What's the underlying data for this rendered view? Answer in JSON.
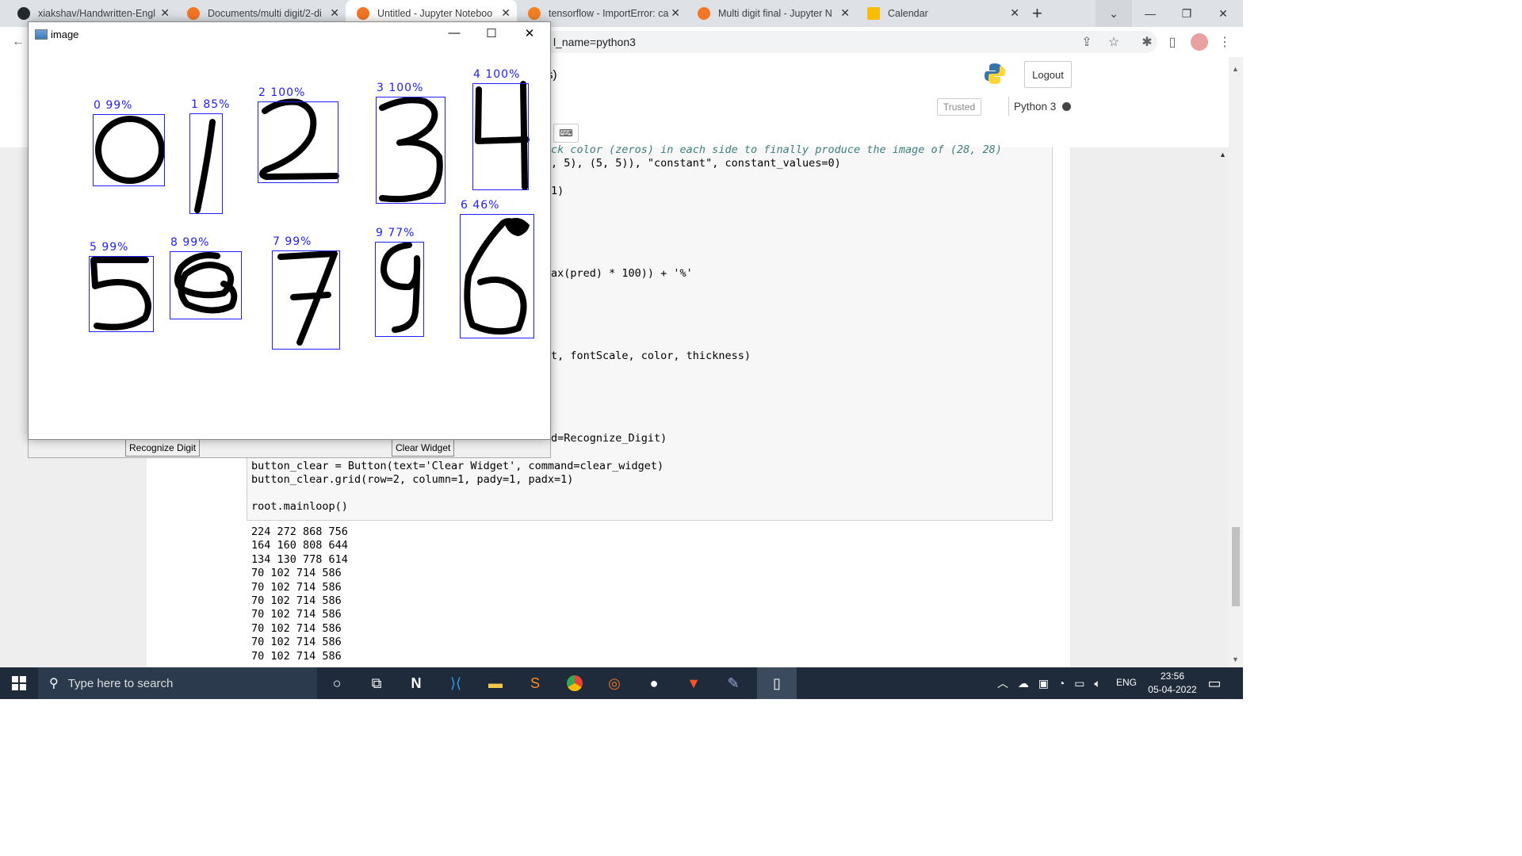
{
  "browser": {
    "tabs": [
      {
        "title": "xiakshav/Handwritten-Engl",
        "icon": "github-icon"
      },
      {
        "title": "Documents/multi digit/2-di",
        "icon": "jupyter-icon"
      },
      {
        "title": "Untitled - Jupyter Noteboo",
        "icon": "jupyter-icon"
      },
      {
        "title": "tensorflow - ImportError: ca",
        "icon": "stackoverflow-icon"
      },
      {
        "title": "Multi digit final - Jupyter N",
        "icon": "jupyter-icon"
      },
      {
        "title": "Calendar",
        "icon": "calendar-icon"
      }
    ],
    "new_tab": "+",
    "url_fragment": "l_name=python3"
  },
  "jupyter": {
    "header_fragment": "s)",
    "logout_label": "Logout",
    "trusted_label": "Trusted",
    "kernel_label": "Python 3",
    "keyboard_icon": "⌨"
  },
  "code": {
    "lines": [
      {
        "t": "ck color (zeros) in each side to finally produce the image of (28, 28)"
      },
      {
        "t": ", 5), (5, 5)), \"constant\", constant_values=0)"
      },
      {
        "t": "1)"
      },
      {
        "t": "ax(pred) * 100)) + '%'"
      },
      {
        "t": "t, fontScale, color, thickness)"
      },
      {
        "t": "d=Recognize_Digit)"
      },
      {
        "t": "button_clear = Button(text='Clear Widget', command=clear_widget)"
      },
      {
        "t": "button_clear.grid(row=2, column=1, pady=1, padx=1)"
      },
      {
        "t": "root.mainloop()"
      }
    ]
  },
  "output": {
    "lines": [
      "224 272 868 756",
      "164 160 808 644",
      "134 130 778 614",
      "70 102 714 586",
      "70 102 714 586",
      "70 102 714 586",
      "70 102 714 586",
      "70 102 714 586",
      "70 102 714 586",
      "70 102 714 586"
    ]
  },
  "cv_window": {
    "title": "image",
    "predictions": [
      {
        "label": "0 99%",
        "digit": "0"
      },
      {
        "label": "1 85%",
        "digit": "1"
      },
      {
        "label": "2 100%",
        "digit": "2"
      },
      {
        "label": "3 100%",
        "digit": "3"
      },
      {
        "label": "4 100%",
        "digit": "4"
      },
      {
        "label": "5 99%",
        "digit": "5"
      },
      {
        "label": "8 99%",
        "digit": "8"
      },
      {
        "label": "7 99%",
        "digit": "7"
      },
      {
        "label": "9 77%",
        "digit": "9"
      },
      {
        "label": "6 46%",
        "digit": "6"
      }
    ]
  },
  "tk": {
    "recognize_label": "Recognize Digit",
    "clear_label": "Clear Widget"
  },
  "taskbar": {
    "search_placeholder": "Type here to search",
    "language": "ENG",
    "time": "23:56",
    "date": "05-04-2022"
  },
  "colors": {
    "box_blue": "#2020ff",
    "taskbar_bg": "#1f2b3a"
  }
}
